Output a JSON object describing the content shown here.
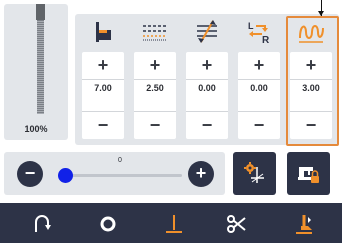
{
  "level": {
    "percent_label": "100%",
    "fill_fraction": 1.0
  },
  "columns": [
    {
      "key": "stitch-length",
      "icon": "stitch-length-icon",
      "value": "7.00",
      "plus": "+",
      "minus": "−"
    },
    {
      "key": "stitch-density",
      "icon": "stitch-density-icon",
      "value": "2.50",
      "plus": "+",
      "minus": "−"
    },
    {
      "key": "stitch-offset",
      "icon": "stitch-offset-icon",
      "value": "0.00",
      "plus": "+",
      "minus": "−"
    },
    {
      "key": "left-right-shift",
      "icon": "left-right-shift-icon",
      "value": "0.00",
      "plus": "+",
      "minus": "−"
    },
    {
      "key": "zigzag-width",
      "icon": "zigzag-width-icon",
      "value": "3.00",
      "plus": "+",
      "minus": "−",
      "highlighted": true
    }
  ],
  "speed": {
    "value_label": "0",
    "minus": "−",
    "plus": "+",
    "fraction": 0.0
  },
  "buttons": {
    "needle_settings": "needle-settings-icon",
    "machine_lock": "sewing-machine-lock-icon"
  },
  "toolbar": [
    {
      "name": "return-icon"
    },
    {
      "name": "circle-icon"
    },
    {
      "name": "needle-position-icon"
    },
    {
      "name": "scissors-icon"
    },
    {
      "name": "presser-foot-icon"
    }
  ],
  "colors": {
    "accent": "#1121e8",
    "highlight": "#e58a3b",
    "icon_orange": "#f0902b",
    "dark": "#2d3347"
  }
}
